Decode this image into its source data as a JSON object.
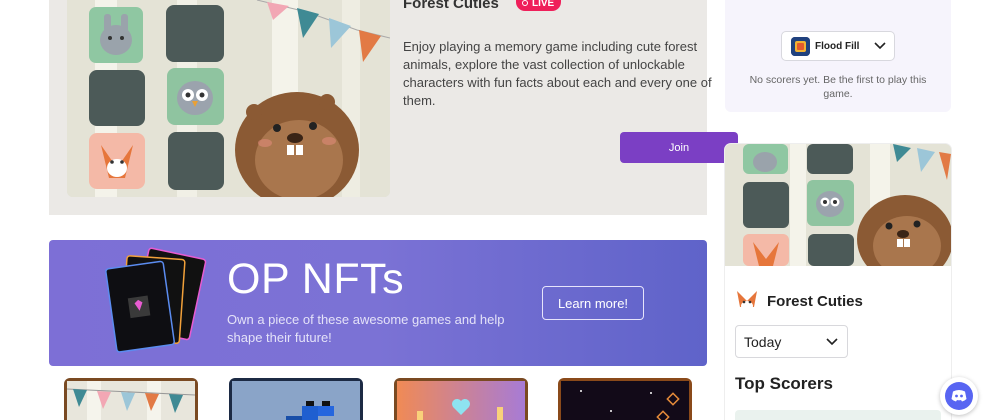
{
  "featured": {
    "title": "Forest Cuties",
    "live_label": "LIVE",
    "description": "Enjoy playing a memory game including cute forest animals, explore the vast collection of unlockable characters with fun facts about each and every one of them.",
    "join_label": "Join"
  },
  "nft_banner": {
    "title": "OP NFTs",
    "description": "Own a piece of these awesome games and help shape their future!",
    "cta_label": "Learn more!"
  },
  "scorers_panel": {
    "game_selected": "Flood Fill",
    "empty_message": "No scorers yet. Be the first to play this game."
  },
  "game_card": {
    "title": "Forest Cuties",
    "period_selected": "Today",
    "top_scorers_heading": "Top Scorers"
  },
  "icons": {
    "discord": "discord-icon",
    "chevron": "chevron-down-icon"
  },
  "colors": {
    "accent_purple": "#7b3fc4",
    "live_red": "#ef1f5a",
    "banner_start": "#7d6fd6",
    "banner_end": "#5f63c9"
  }
}
